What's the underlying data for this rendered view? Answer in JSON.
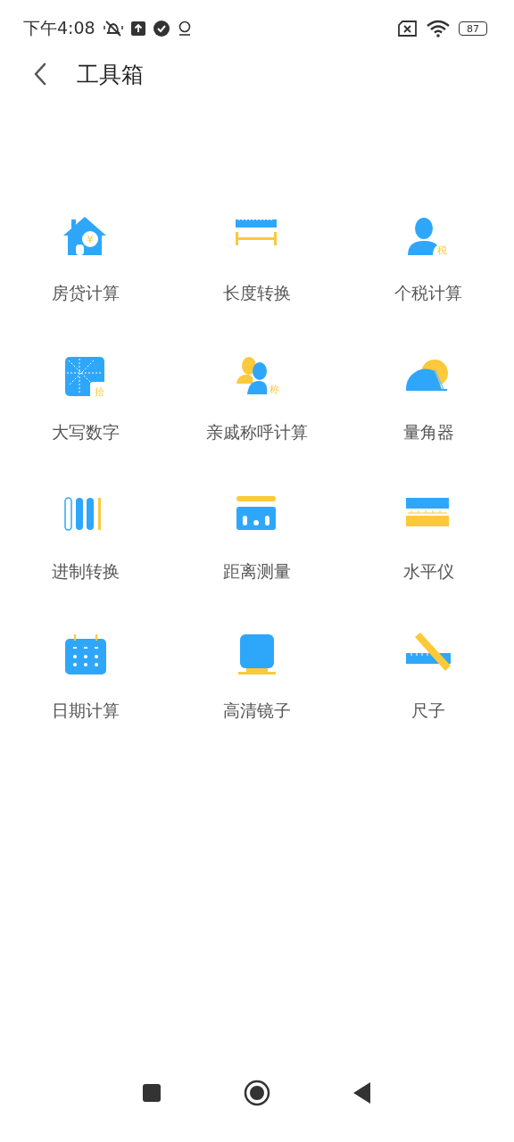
{
  "status_bar": {
    "time": "下午4:08",
    "battery": "87"
  },
  "header": {
    "title": "工具箱"
  },
  "tools": [
    {
      "label": "房贷计算",
      "kind": "house",
      "badge": "¥"
    },
    {
      "label": "长度转换",
      "kind": "length"
    },
    {
      "label": "个税计算",
      "kind": "person",
      "badge": "税"
    },
    {
      "label": "大写数字",
      "kind": "numeral",
      "badge": "拾"
    },
    {
      "label": "亲戚称呼计算",
      "kind": "relatives",
      "badge": "称"
    },
    {
      "label": "量角器",
      "kind": "protractor"
    },
    {
      "label": "进制转换",
      "kind": "bars"
    },
    {
      "label": "距离测量",
      "kind": "distance"
    },
    {
      "label": "水平仪",
      "kind": "level"
    },
    {
      "label": "日期计算",
      "kind": "calendar"
    },
    {
      "label": "高清镜子",
      "kind": "mirror"
    },
    {
      "label": "尺子",
      "kind": "ruler"
    }
  ]
}
